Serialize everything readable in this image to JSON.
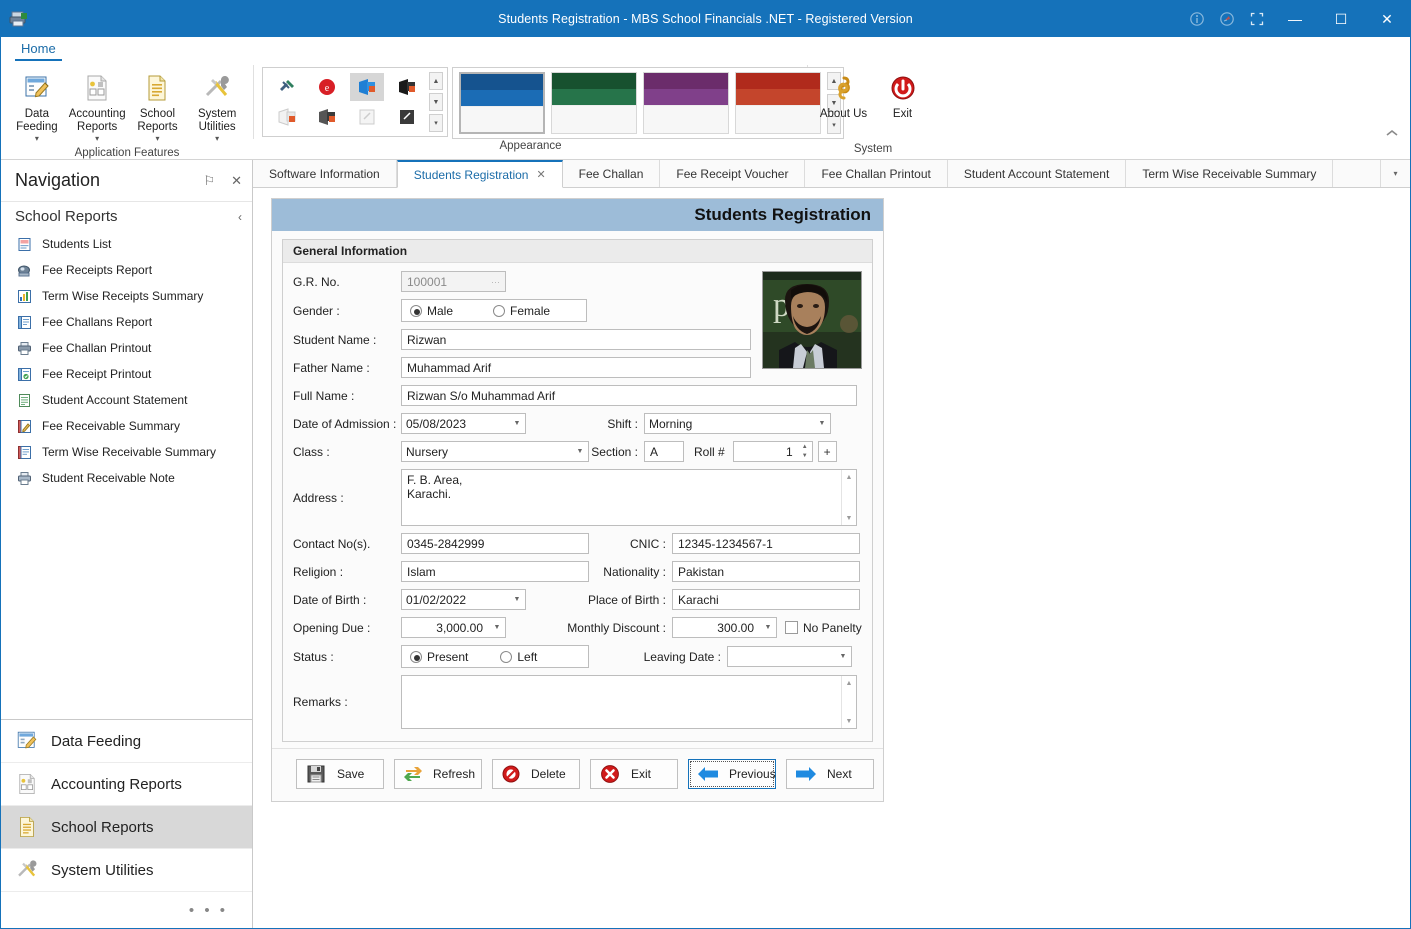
{
  "window": {
    "title": "Students Registration - MBS School Financials .NET - Registered Version",
    "app_icon": "printer-app-icon",
    "info_icon": "info-icon",
    "pin_icon": "pin-balloon-icon",
    "fullscreen_icon": "fullscreen-icon",
    "minimize": "—",
    "maximize": "☐",
    "close": "✕",
    "accent": "#1572ba"
  },
  "ribbon": {
    "tabs": [
      {
        "label": "Home"
      }
    ],
    "groups": [
      {
        "name": "Application Features",
        "label": "Application Features",
        "buttons": [
          {
            "label": "Data Feeding",
            "icon": "data-feeding-icon",
            "has_dropdown": true
          },
          {
            "label": "Accounting Reports",
            "icon": "accounting-reports-icon",
            "has_dropdown": true
          },
          {
            "label": "School Reports",
            "icon": "school-reports-icon",
            "has_dropdown": true
          },
          {
            "label": "System Utilities",
            "icon": "system-utilities-icon",
            "has_dropdown": true
          }
        ]
      },
      {
        "name": "Appearance",
        "label": "Appearance",
        "style_icons": [
          {
            "name": "skin-office2013-icon",
            "selected": false
          },
          {
            "name": "skin-red-circle-icon",
            "selected": false
          },
          {
            "name": "skin-blue-office-icon",
            "selected": true
          },
          {
            "name": "skin-black-office-icon",
            "selected": false
          },
          {
            "name": "skin-white-office-icon",
            "selected": false
          },
          {
            "name": "skin-dark-office-icon",
            "selected": false
          },
          {
            "name": "skin-light-form-icon",
            "selected": false
          },
          {
            "name": "skin-dark-form-icon",
            "selected": false
          }
        ],
        "themes": [
          {
            "name": "theme-blue",
            "dark": "#15538f",
            "mid": "#1b6cb5",
            "selected": true
          },
          {
            "name": "theme-green",
            "dark": "#17512f",
            "mid": "#26744a",
            "selected": false
          },
          {
            "name": "theme-purple",
            "dark": "#6b2c6b",
            "mid": "#80408a",
            "selected": false
          },
          {
            "name": "theme-red",
            "dark": "#b02a1c",
            "mid": "#c4452c",
            "selected": false
          }
        ]
      },
      {
        "name": "System",
        "label": "System",
        "buttons": [
          {
            "label": "About Us",
            "icon": "about-us-icon",
            "has_dropdown": false
          },
          {
            "label": "Exit",
            "icon": "exit-power-icon",
            "has_dropdown": false
          }
        ]
      }
    ],
    "collapse_icon": "chevron-up-icon"
  },
  "doc_tabs": {
    "items": [
      {
        "label": "Software Information",
        "active": false,
        "closable": false
      },
      {
        "label": "Students Registration",
        "active": true,
        "closable": true
      },
      {
        "label": "Fee Challan",
        "active": false,
        "closable": false
      },
      {
        "label": "Fee Receipt Voucher",
        "active": false,
        "closable": false
      },
      {
        "label": "Fee Challan Printout",
        "active": false,
        "closable": false
      },
      {
        "label": "Student Account Statement",
        "active": false,
        "closable": false
      },
      {
        "label": "Term Wise Receivable Summary",
        "active": false,
        "closable": false
      }
    ],
    "close_glyph": "✕",
    "overflow_glyph": "▾"
  },
  "navigation": {
    "title": "Navigation",
    "pin_glyph": "⚐",
    "close_glyph": "✕",
    "group_title": "School Reports",
    "collapse_glyph": "‹",
    "items": [
      {
        "label": "Students List",
        "icon": "students-list-icon"
      },
      {
        "label": "Fee Receipts Report",
        "icon": "fee-receipts-report-icon"
      },
      {
        "label": "Term Wise Receipts Summary",
        "icon": "term-wise-receipts-summary-icon"
      },
      {
        "label": "Fee Challans Report",
        "icon": "fee-challans-report-icon"
      },
      {
        "label": "Fee Challan Printout",
        "icon": "fee-challan-printout-icon"
      },
      {
        "label": "Fee Receipt Printout",
        "icon": "fee-receipt-printout-icon"
      },
      {
        "label": "Student Account Statement",
        "icon": "student-account-statement-icon"
      },
      {
        "label": "Fee Receivable Summary",
        "icon": "fee-receivable-summary-icon"
      },
      {
        "label": "Term Wise Receivable Summary",
        "icon": "term-wise-receivable-summary-icon"
      },
      {
        "label": "Student Receivable Note",
        "icon": "student-receivable-note-icon"
      }
    ],
    "sections": [
      {
        "label": "Data Feeding",
        "icon": "data-feeding-icon",
        "selected": false
      },
      {
        "label": "Accounting Reports",
        "icon": "accounting-reports-icon",
        "selected": false
      },
      {
        "label": "School Reports",
        "icon": "school-reports-icon",
        "selected": true
      },
      {
        "label": "System Utilities",
        "icon": "system-utilities-icon",
        "selected": false
      }
    ],
    "more_glyph": "• • •"
  },
  "form": {
    "title": "Students Registration",
    "group_title": "General Information",
    "photo_alt": "student-photo",
    "fields": {
      "gr_no_label": "G.R. No.",
      "gr_no_value": "100001",
      "gr_no_ellipsis": "···",
      "gender_label": "Gender :",
      "gender_male": "Male",
      "gender_female": "Female",
      "gender_selected": "Male",
      "student_name_label": "Student Name :",
      "student_name_value": "Rizwan",
      "father_name_label": "Father Name :",
      "father_name_value": "Muhammad Arif",
      "full_name_label": "Full Name :",
      "full_name_value": "Rizwan S/o Muhammad Arif",
      "doa_label": "Date of Admission :",
      "doa_value": "05/08/2023",
      "shift_label": "Shift :",
      "shift_value": "Morning",
      "class_label": "Class :",
      "class_value": "Nursery",
      "section_label": "Section :",
      "section_value": "A",
      "roll_label": "Roll #",
      "roll_value": "1",
      "roll_plus": "+",
      "address_label": "Address :",
      "address_value": "F. B. Area,\nKarachi.",
      "contact_label": "Contact No(s).",
      "contact_value": "0345-2842999",
      "cnic_label": "CNIC :",
      "cnic_value": "12345-1234567-1",
      "religion_label": "Religion :",
      "religion_value": "Islam",
      "nationality_label": "Nationality :",
      "nationality_value": "Pakistan",
      "dob_label": "Date of Birth :",
      "dob_value": "01/02/2022",
      "pob_label": "Place of Birth :",
      "pob_value": "Karachi",
      "opening_due_label": "Opening Due :",
      "opening_due_value": "3,000.00",
      "monthly_discount_label": "Monthly Discount :",
      "monthly_discount_value": "300.00",
      "no_penalty_label": "No Panelty",
      "no_penalty_checked": false,
      "status_label": "Status :",
      "status_present": "Present",
      "status_left": "Left",
      "status_selected": "Present",
      "leaving_date_label": "Leaving Date :",
      "leaving_date_value": "",
      "remarks_label": "Remarks :",
      "remarks_value": ""
    },
    "buttons": [
      {
        "name": "save",
        "label": "Save",
        "accel": "S",
        "icon": "save-disk-icon",
        "focused": false
      },
      {
        "name": "refresh",
        "label": "Refresh",
        "accel": "R",
        "icon": "refresh-arrows-icon",
        "focused": false
      },
      {
        "name": "delete",
        "label": "Delete",
        "accel": "D",
        "icon": "delete-forbid-icon",
        "focused": false
      },
      {
        "name": "exit",
        "label": "Exit",
        "accel": "x",
        "icon": "exit-cross-icon",
        "focused": false
      },
      {
        "name": "previous",
        "label": "Previous",
        "accel": "P",
        "icon": "arrow-left-icon",
        "focused": true
      },
      {
        "name": "next",
        "label": "Next",
        "accel": "N",
        "icon": "arrow-right-icon",
        "focused": false
      }
    ]
  }
}
